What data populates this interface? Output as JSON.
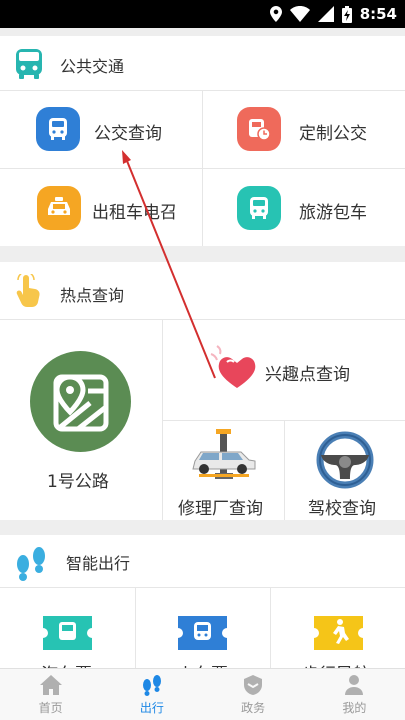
{
  "statusbar": {
    "time": "8:54"
  },
  "public_transport": {
    "title": "公共交通",
    "items": [
      {
        "label": "公交查询",
        "icon": "bus-icon",
        "color": "#2f7fd6"
      },
      {
        "label": "定制公交",
        "icon": "custom-bus-icon",
        "color": "#ef6a5b"
      },
      {
        "label": "出租车电召",
        "icon": "taxi-icon",
        "color": "#f5a623"
      },
      {
        "label": "旅游包车",
        "icon": "tour-bus-icon",
        "color": "#27c3b3"
      }
    ]
  },
  "hot_query": {
    "title": "热点查询",
    "items": [
      {
        "label": "1号公路",
        "icon": "map-pin-icon"
      },
      {
        "label": "兴趣点查询",
        "icon": "heart-icon"
      },
      {
        "label": "修理厂查询",
        "icon": "car-lift-icon"
      },
      {
        "label": "驾校查询",
        "icon": "steering-wheel-icon"
      }
    ]
  },
  "smart_travel": {
    "title": "智能出行",
    "items": [
      {
        "label": "汽车票",
        "icon": "bus-ticket-icon",
        "color": "#27c3b3"
      },
      {
        "label": "火车票",
        "icon": "train-ticket-icon",
        "color": "#2f7fd6"
      },
      {
        "label": "步行导航",
        "icon": "walk-ticket-icon",
        "color": "#f5c518"
      }
    ]
  },
  "tabbar": {
    "tabs": [
      {
        "label": "首页",
        "icon": "home-icon",
        "active": false
      },
      {
        "label": "出行",
        "icon": "footprints-icon",
        "active": true
      },
      {
        "label": "政务",
        "icon": "shield-icon",
        "active": false
      },
      {
        "label": "我的",
        "icon": "user-icon",
        "active": false
      }
    ]
  },
  "colors": {
    "accent": "#1e88e5",
    "annotation_arrow": "#d32f2f"
  }
}
